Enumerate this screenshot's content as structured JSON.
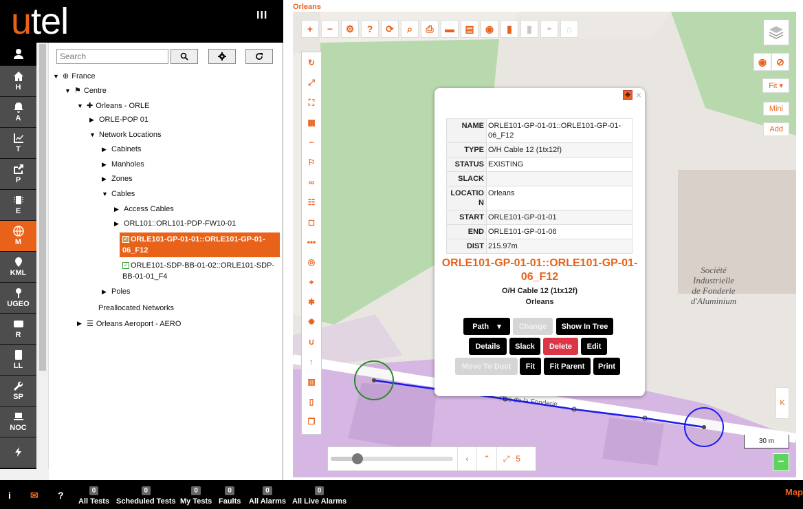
{
  "brand": {
    "logo_u": "u",
    "logo_rest": "tel",
    "menu_glyph": "III"
  },
  "nav": [
    {
      "label": "",
      "icon": "user-icon"
    },
    {
      "label": "H",
      "icon": "home-icon"
    },
    {
      "label": "A",
      "icon": "bell-icon"
    },
    {
      "label": "T",
      "icon": "chart-icon"
    },
    {
      "label": "P",
      "icon": "share-icon"
    },
    {
      "label": "E",
      "icon": "chip-icon"
    },
    {
      "label": "M",
      "icon": "globe-icon",
      "active": true
    },
    {
      "label": "KML",
      "icon": "pin-icon"
    },
    {
      "label": "UGEO",
      "icon": "pin-icon"
    },
    {
      "label": "R",
      "icon": "drive-icon"
    },
    {
      "label": "LL",
      "icon": "book-icon"
    },
    {
      "label": "SP",
      "icon": "wrench-icon"
    },
    {
      "label": "NOC",
      "icon": "laptop-icon"
    },
    {
      "label": "",
      "icon": "bolt-icon"
    }
  ],
  "search": {
    "placeholder": "Search"
  },
  "tree": {
    "france": "France",
    "centre": "Centre",
    "orleans": "Orleans - ORLE",
    "pop": "ORLE-POP 01",
    "netloc": "Network Locations",
    "cabinets": "Cabinets",
    "manholes": "Manholes",
    "zones": "Zones",
    "cables": "Cables",
    "access": "Access Cables",
    "fw10": "ORL101::ORL101-PDP-FW10-01",
    "sel_cable": "ORLE101-GP-01-01::ORLE101-GP-01-06_F12",
    "sdp_cable": "ORLE101-SDP-BB-01-02::ORLE101-SDP-BB-01-01_F4",
    "poles": "Poles",
    "prealloc": "Preallocated Networks",
    "aero": "Orleans Aeroport - AERO"
  },
  "map": {
    "title": "Orleans",
    "street": "Rue de la Fonderie",
    "building": "Société Industrielle de Fonderie d'Aluminium",
    "right_buttons": {
      "fit": "Fit",
      "mini": "Mini",
      "add": "Add",
      "k": "K"
    },
    "scale": "30 m",
    "zoom_level": "5",
    "slider_fraction": 0.22
  },
  "popup": {
    "props": [
      {
        "k": "NAME",
        "v": "ORLE101-GP-01-01::ORLE101-GP-01-06_F12"
      },
      {
        "k": "TYPE",
        "v": "O/H Cable 12 (1tx12f)"
      },
      {
        "k": "STATUS",
        "v": "EXISTING"
      },
      {
        "k": "SLACK",
        "v": ""
      },
      {
        "k": "LOCATION",
        "v": "Orleans"
      },
      {
        "k": "START",
        "v": "ORLE101-GP-01-01"
      },
      {
        "k": "END",
        "v": "ORLE101-GP-01-06"
      },
      {
        "k": "DIST",
        "v": "215.97m"
      }
    ],
    "title": "ORLE101-GP-01-01::ORLE101-GP-01-06_F12",
    "subtitle": "O/H Cable 12 (1tx12f)",
    "location": "Orleans",
    "buttons": {
      "path": "Path",
      "change": "Change",
      "show_tree": "Show In Tree",
      "details": "Details",
      "slack": "Slack",
      "delete": "Delete",
      "edit": "Edit",
      "move_duct": "Move To Duct",
      "fit": "Fit",
      "fit_parent": "Fit Parent",
      "print": "Print"
    }
  },
  "footer": {
    "stats": [
      {
        "count": "0",
        "label": "All Tests"
      },
      {
        "count": "0",
        "label": "Scheduled Tests"
      },
      {
        "count": "0",
        "label": "My Tests"
      },
      {
        "count": "0",
        "label": "Faults"
      },
      {
        "count": "0",
        "label": "All Alarms"
      },
      {
        "count": "0",
        "label": "All Live Alarms"
      }
    ],
    "map_label": "Map"
  },
  "colors": {
    "accent": "#e8621a",
    "cable": "#1a1aff",
    "green_area": "#b8d9ae",
    "purple_area": "#d8b8e8"
  }
}
